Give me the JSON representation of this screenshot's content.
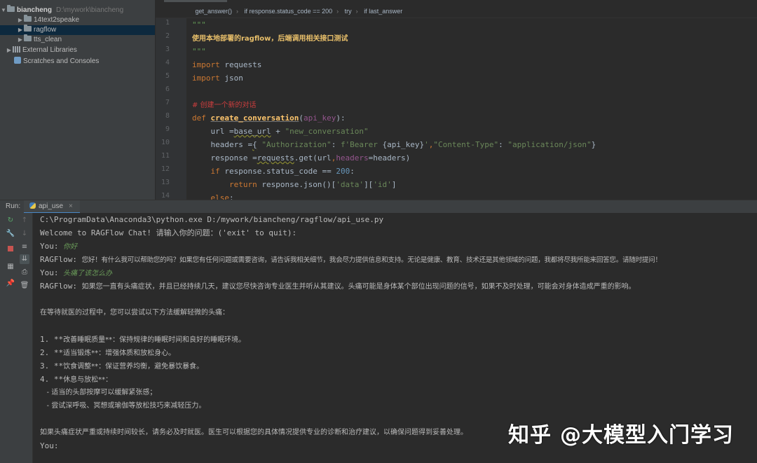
{
  "project": {
    "root": {
      "name": "biancheng",
      "path": "D:\\mywork\\biancheng"
    },
    "items": [
      {
        "label": "14text2speake"
      },
      {
        "label": "ragflow"
      },
      {
        "label": "tts_clean"
      }
    ],
    "external_libraries": "External Libraries",
    "scratches": "Scratches and Consoles"
  },
  "breadcrumb": [
    "get_answer()",
    "if response.status_code == 200",
    "try",
    "if last_answer"
  ],
  "code": {
    "line_numbers": [
      "1",
      "2",
      "3",
      "4",
      "5",
      "6",
      "7",
      "8",
      "9",
      "10",
      "11",
      "12",
      "13",
      "14"
    ],
    "doc_open": "\"\"\"",
    "doc_text": "使用本地部署的ragflow，后端调用相关接口测试",
    "doc_close": "\"\"\"",
    "import1_kw": "import",
    "import1_mod": " requests",
    "import2_kw": "import",
    "import2_mod": " json",
    "comment": "# 创建一个新的对话",
    "def_kw": "def ",
    "def_name": "create_conversation",
    "def_open": "(",
    "def_param": "api_key",
    "def_close": "):",
    "l9_a": "    url =",
    "l9_b": "base_url",
    "l9_c": " + ",
    "l9_d": "\"new_conversation\"",
    "l10_a": "    headers =",
    "l10_b": "{",
    "l10_c": " \"Authorization\"",
    "l10_d": ": ",
    "l10_e": "f'Bearer ",
    "l10_f": "{api_key}",
    "l10_g": "'",
    "l10_h": ",",
    "l10_i": "\"Content-Type\"",
    "l10_j": ": ",
    "l10_k": "\"application/json\"",
    "l10_l": "}",
    "l11_a": "    response =",
    "l11_b": "requests",
    "l11_c": ".get(url",
    "l11_d": ",",
    "l11_e": "headers",
    "l11_f": "=headers)",
    "l12_kw": "    if",
    "l12_a": " response.status_code == ",
    "l12_num": "200",
    "l12_b": ":",
    "l13_kw": "        return",
    "l13_a": " response.json()[",
    "l13_s1": "'data'",
    "l13_b": "][",
    "l13_s2": "'id'",
    "l13_c": "]",
    "l14_kw": "    else",
    "l14_a": ":"
  },
  "run": {
    "label": "Run:",
    "tab": "api_use",
    "command": "C:\\ProgramData\\Anaconda3\\python.exe D:/mywork/biancheng/ragflow/api_use.py",
    "welcome": "Welcome to RAGFlow Chat! 请输入你的问题：('exit' to quit):",
    "you1_label": "You: ",
    "you1_text": "你好",
    "reply1_label": "RAGFlow: ",
    "reply1_text": "您好！有什么我可以帮助您的吗？如果您有任何问题或需要咨询，请告诉我相关细节，我会尽力提供信息和支持。无论是健康、教育、技术还是其他领域的问题，我都将尽我所能来回答您。请随时提问！",
    "you2_label": "You: ",
    "you2_text": "头痛了该怎么办",
    "reply2_label": "RAGFlow: ",
    "reply2_text": "如果您一直有头痛症状，并且已经持续几天，建议您尽快咨询专业医生并听从其建议。头痛可能是身体某个部位出现问题的信号，如果不及时处理，可能会对身体造成严重的影响。",
    "intro": "在等待就医的过程中，您可以尝试以下方法缓解轻微的头痛：",
    "list": [
      {
        "num": "1. **",
        "title": "改善睡眠质量",
        "rest": "**：保持规律的睡眠时间和良好的睡眠环境。"
      },
      {
        "num": "2. **",
        "title": "适当锻炼",
        "rest": "**：增强体质和放松身心。"
      },
      {
        "num": "3. **",
        "title": "饮食调整",
        "rest": "**：保证营养均衡，避免暴饮暴食。"
      },
      {
        "num": "4. **",
        "title": "休息与放松",
        "rest": "**："
      }
    ],
    "sub1": "   - 适当的头部按摩可以缓解紧张感；",
    "sub2": "   - 尝试深呼吸、冥想或瑜伽等放松技巧来减轻压力。",
    "closing": "如果头痛症状严重或持续时间较长，请务必及时就医。医生可以根据您的具体情况提供专业的诊断和治疗建议，以确保问题得到妥善处理。",
    "prompt": "You:"
  },
  "watermark": {
    "site": "知乎",
    "author": "@大模型入门学习"
  },
  "colors": {
    "keyword": "#cc7832",
    "string": "#6a8759",
    "comment": "#cc3e3e",
    "number": "#6897bb",
    "user_input": "#6a9b59",
    "accent": "#4a88c7"
  }
}
